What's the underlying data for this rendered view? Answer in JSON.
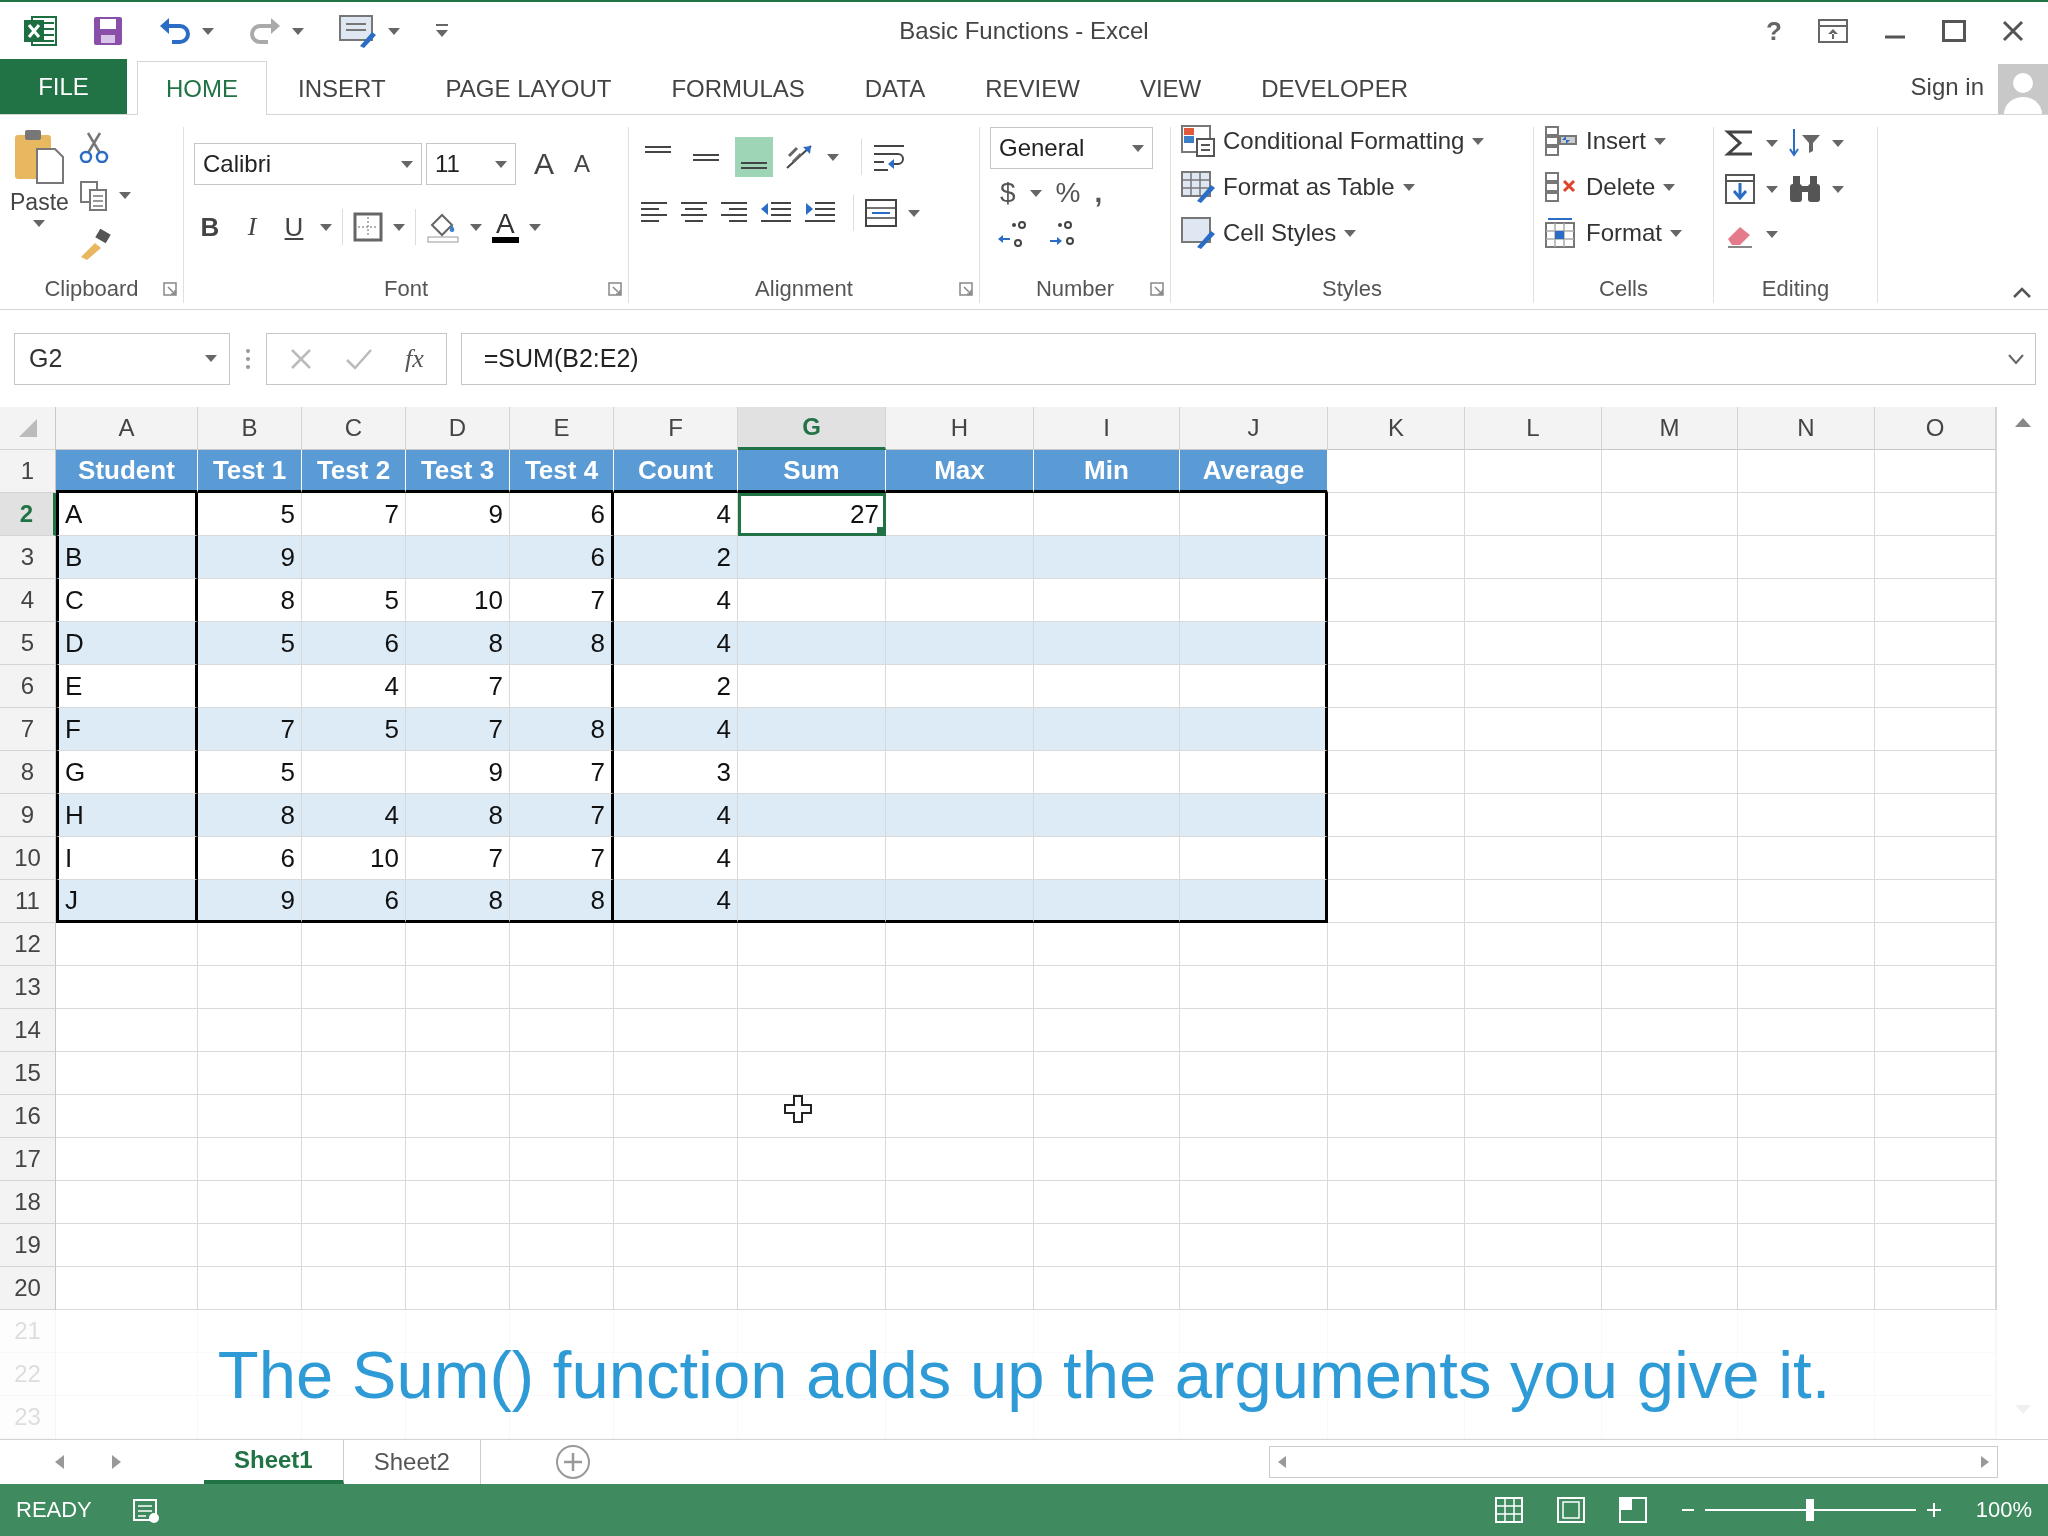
{
  "window": {
    "title": "Basic Functions - Excel",
    "help": "?"
  },
  "ribbon_tabs": [
    {
      "label": "FILE",
      "kind": "file",
      "selected": false
    },
    {
      "label": "HOME",
      "kind": "tab",
      "selected": true
    },
    {
      "label": "INSERT",
      "kind": "tab",
      "selected": false
    },
    {
      "label": "PAGE LAYOUT",
      "kind": "tab",
      "selected": false
    },
    {
      "label": "FORMULAS",
      "kind": "tab",
      "selected": false
    },
    {
      "label": "DATA",
      "kind": "tab",
      "selected": false
    },
    {
      "label": "REVIEW",
      "kind": "tab",
      "selected": false
    },
    {
      "label": "VIEW",
      "kind": "tab",
      "selected": false
    },
    {
      "label": "DEVELOPER",
      "kind": "tab",
      "selected": false
    }
  ],
  "account": {
    "label": "Sign in"
  },
  "ribbon": {
    "clipboard": {
      "label": "Clipboard",
      "paste": "Paste"
    },
    "font": {
      "label": "Font",
      "font_name": "Calibri",
      "font_size": "11",
      "grow": "A",
      "shrink": "A",
      "bold": "B",
      "italic": "I",
      "underline": "U",
      "font_color": "A"
    },
    "alignment": {
      "label": "Alignment",
      "vertical": [
        {
          "kind": "top",
          "selected": false
        },
        {
          "kind": "middle",
          "selected": false
        },
        {
          "kind": "bottom",
          "selected": true
        }
      ]
    },
    "number": {
      "label": "Number",
      "format": "General",
      "currency": "$",
      "percent": "%",
      "comma": ","
    },
    "styles": {
      "label": "Styles",
      "items": [
        {
          "label": "Conditional Formatting",
          "kind": "conditional"
        },
        {
          "label": "Format as Table",
          "kind": "table"
        },
        {
          "label": "Cell Styles",
          "kind": "styles"
        }
      ]
    },
    "cells": {
      "label": "Cells",
      "items": [
        {
          "label": "Insert",
          "kind": "insert"
        },
        {
          "label": "Delete",
          "kind": "delete"
        },
        {
          "label": "Format",
          "kind": "format"
        }
      ]
    },
    "editing": {
      "label": "Editing"
    }
  },
  "formula_bar": {
    "name_box": "G2",
    "function_label": "fx",
    "formula": "=SUM(B2:E2)"
  },
  "columns": [
    {
      "label": "A",
      "selected": false
    },
    {
      "label": "B",
      "selected": false
    },
    {
      "label": "C",
      "selected": false
    },
    {
      "label": "D",
      "selected": false
    },
    {
      "label": "E",
      "selected": false
    },
    {
      "label": "F",
      "selected": false
    },
    {
      "label": "G",
      "selected": true
    },
    {
      "label": "H",
      "selected": false
    },
    {
      "label": "I",
      "selected": false
    },
    {
      "label": "J",
      "selected": false
    },
    {
      "label": "K",
      "selected": false
    },
    {
      "label": "L",
      "selected": false
    },
    {
      "label": "M",
      "selected": false
    },
    {
      "label": "N",
      "selected": false
    },
    {
      "label": "O",
      "selected": false
    }
  ],
  "rows": [
    {
      "number": "1",
      "selected": false,
      "kind": "header",
      "cells": [
        "Student",
        "Test 1",
        "Test 2",
        "Test 3",
        "Test 4",
        "Count",
        "Sum",
        "Max",
        "Min",
        "Average"
      ]
    },
    {
      "number": "2",
      "selected": true,
      "kind": "data",
      "shaded": false,
      "cells": [
        "A",
        "5",
        "7",
        "9",
        "6",
        "4",
        "27"
      ]
    },
    {
      "number": "3",
      "selected": false,
      "kind": "data",
      "shaded": true,
      "cells": [
        "B",
        "9",
        null,
        null,
        "6",
        "2"
      ]
    },
    {
      "number": "4",
      "selected": false,
      "kind": "data",
      "shaded": false,
      "cells": [
        "C",
        "8",
        "5",
        "10",
        "7",
        "4"
      ]
    },
    {
      "number": "5",
      "selected": false,
      "kind": "data",
      "shaded": true,
      "cells": [
        "D",
        "5",
        "6",
        "8",
        "8",
        "4"
      ]
    },
    {
      "number": "6",
      "selected": false,
      "kind": "data",
      "shaded": false,
      "cells": [
        "E",
        null,
        "4",
        "7",
        null,
        "2"
      ]
    },
    {
      "number": "7",
      "selected": false,
      "kind": "data",
      "shaded": true,
      "cells": [
        "F",
        "7",
        "5",
        "7",
        "8",
        "4"
      ]
    },
    {
      "number": "8",
      "selected": false,
      "kind": "data",
      "shaded": false,
      "cells": [
        "G",
        "5",
        null,
        "9",
        "7",
        "3"
      ]
    },
    {
      "number": "9",
      "selected": false,
      "kind": "data",
      "shaded": true,
      "cells": [
        "H",
        "8",
        "4",
        "8",
        "7",
        "4"
      ]
    },
    {
      "number": "10",
      "selected": false,
      "kind": "data",
      "shaded": false,
      "cells": [
        "I",
        "6",
        "10",
        "7",
        "7",
        "4"
      ]
    },
    {
      "number": "11",
      "selected": false,
      "kind": "data",
      "shaded": true,
      "cells": [
        "J",
        "9",
        "6",
        "8",
        "8",
        "4"
      ]
    },
    {
      "number": "12",
      "selected": false,
      "kind": "empty"
    },
    {
      "number": "13",
      "selected": false,
      "kind": "empty"
    },
    {
      "number": "14",
      "selected": false,
      "kind": "empty"
    },
    {
      "number": "15",
      "selected": false,
      "kind": "empty"
    },
    {
      "number": "16",
      "selected": false,
      "kind": "empty"
    },
    {
      "number": "17",
      "selected": false,
      "kind": "empty"
    },
    {
      "number": "18",
      "selected": false,
      "kind": "empty"
    },
    {
      "number": "19",
      "selected": false,
      "kind": "empty"
    },
    {
      "number": "20",
      "selected": false,
      "kind": "empty"
    },
    {
      "number": "21",
      "selected": false,
      "kind": "empty"
    },
    {
      "number": "22",
      "selected": false,
      "kind": "empty"
    },
    {
      "number": "23",
      "selected": false,
      "kind": "empty"
    }
  ],
  "sheet_tabs": [
    {
      "label": "Sheet1",
      "selected": true
    },
    {
      "label": "Sheet2",
      "selected": false
    }
  ],
  "caption": "The Sum() function adds up the arguments you give it.",
  "status_bar": {
    "state": "READY",
    "zoom": "100%",
    "zoom_slider": {
      "level": 0.5
    }
  }
}
